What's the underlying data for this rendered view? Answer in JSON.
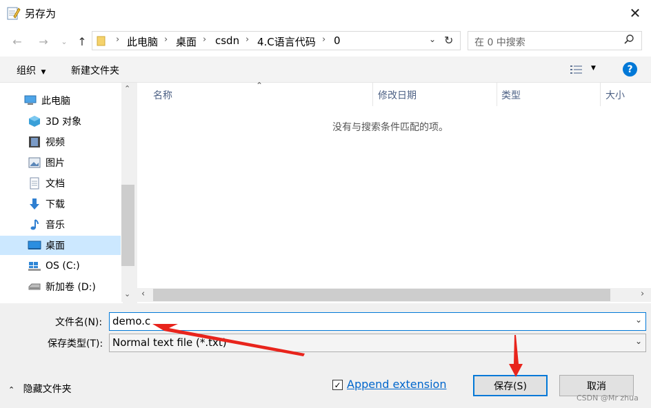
{
  "window": {
    "title": "另存为"
  },
  "breadcrumb": [
    "此电脑",
    "桌面",
    "csdn",
    "4.C语言代码",
    "0"
  ],
  "search": {
    "placeholder": "在 0 中搜索"
  },
  "toolbar": {
    "organize": "组织",
    "new_folder": "新建文件夹"
  },
  "nav": [
    {
      "label": "此电脑",
      "icon": "computer-icon",
      "indent": 1
    },
    {
      "label": "3D 对象",
      "icon": "3d-objects-icon",
      "indent": 2
    },
    {
      "label": "视频",
      "icon": "video-icon",
      "indent": 2
    },
    {
      "label": "图片",
      "icon": "pictures-icon",
      "indent": 2
    },
    {
      "label": "文档",
      "icon": "documents-icon",
      "indent": 2
    },
    {
      "label": "下载",
      "icon": "download-icon",
      "indent": 2
    },
    {
      "label": "音乐",
      "icon": "music-icon",
      "indent": 2
    },
    {
      "label": "桌面",
      "icon": "desktop-icon",
      "indent": 2,
      "selected": true
    },
    {
      "label": "OS (C:)",
      "icon": "windows-drive-icon",
      "indent": 2
    },
    {
      "label": "新加卷 (D:)",
      "icon": "drive-icon",
      "indent": 2
    }
  ],
  "columns": [
    "名称",
    "修改日期",
    "类型",
    "大小"
  ],
  "empty_message": "没有与搜索条件匹配的项。",
  "form": {
    "filename_label": "文件名(N):",
    "filename_value": "demo.c",
    "filetype_label": "保存类型(T):",
    "filetype_value": "Normal text file (*.txt)"
  },
  "footer": {
    "hide_folders": "隐藏文件夹",
    "append_extension": "Append extension",
    "append_checked": true,
    "save": "保存(S)",
    "cancel": "取消"
  },
  "watermark": "CSDN @Mr zhua",
  "colors": {
    "accent": "#0078d7",
    "annotation": "#e8241c",
    "selection": "#cce8ff"
  }
}
